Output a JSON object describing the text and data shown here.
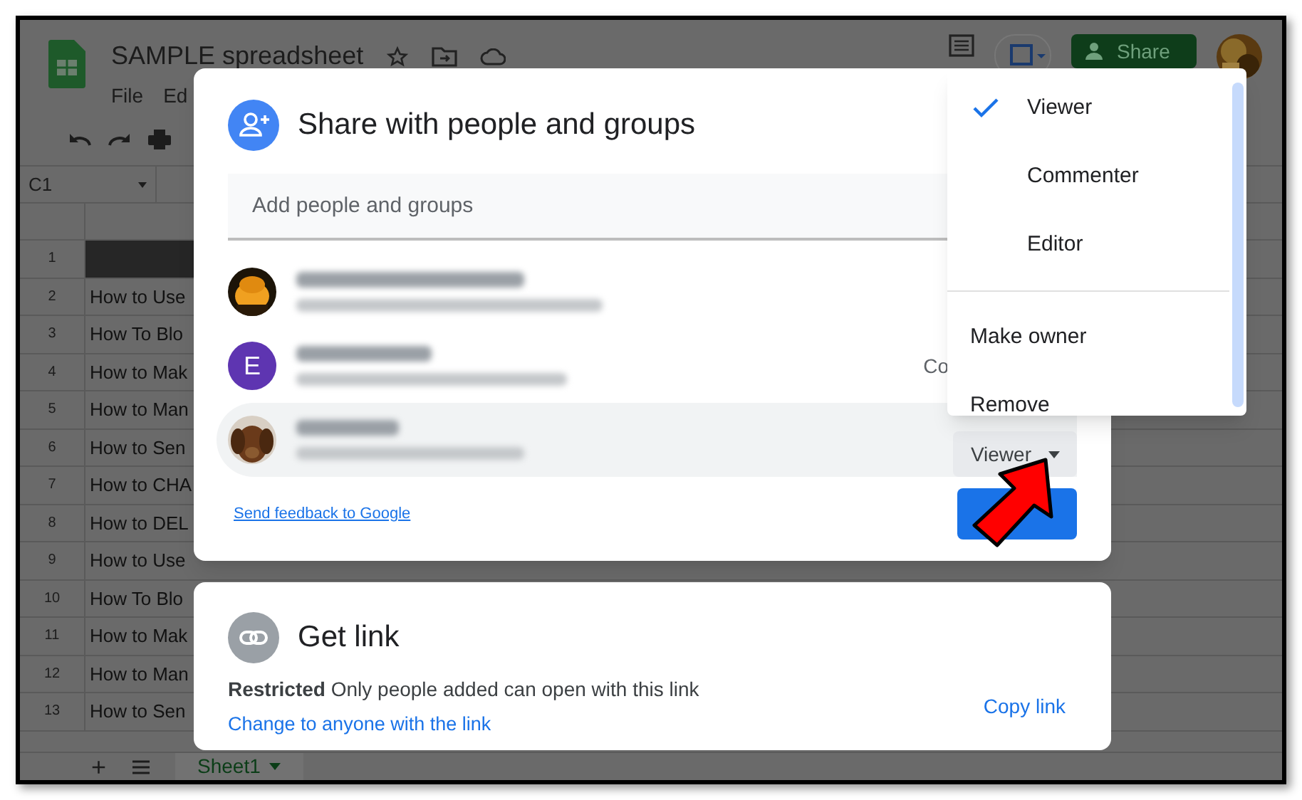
{
  "app": {
    "title": "SAMPLE spreadsheet",
    "menus": [
      "File",
      "Ed"
    ],
    "share_button": "Share",
    "name_box": "C1"
  },
  "sheet": {
    "rows": [
      {
        "number": "1"
      },
      {
        "number": "2",
        "cell": "How to Use"
      },
      {
        "number": "3",
        "cell": "How To Blo"
      },
      {
        "number": "4",
        "cell": "How to Mak"
      },
      {
        "number": "5",
        "cell": "How to Man"
      },
      {
        "number": "6",
        "cell": "How to Sen"
      },
      {
        "number": "7",
        "cell": "How to CHA"
      },
      {
        "number": "8",
        "cell": "How to DEL"
      },
      {
        "number": "9",
        "cell": "How to Use"
      },
      {
        "number": "10",
        "cell": "How To Blo"
      },
      {
        "number": "11",
        "cell": "How to Mak"
      },
      {
        "number": "12",
        "cell": "How to Man"
      },
      {
        "number": "13",
        "cell": "How to Sen"
      }
    ]
  },
  "add_sheet": "+",
  "tabs": [
    {
      "label": "Sheet1",
      "selected": true
    }
  ],
  "dialog": {
    "title": "Share with people and groups",
    "search": {
      "placeholder": "Add people and groups"
    },
    "people": [
      {
        "selected": false
      },
      {
        "avatar": {
          "kind": "letter",
          "letter": "E",
          "color": "#5e35b1"
        },
        "selected": false,
        "role": {
          "kind": "text",
          "label": "Co"
        }
      },
      {
        "selected": true,
        "role": {
          "kind": "dropdown",
          "label": "Viewer"
        }
      }
    ],
    "feedback_link": "Send feedback to Google"
  },
  "role_menu": {
    "items": [
      {
        "kind": "option",
        "label": "Viewer",
        "selected": true
      },
      {
        "kind": "option",
        "label": "Commenter",
        "selected": false
      },
      {
        "kind": "option",
        "label": "Editor",
        "selected": false
      },
      {
        "kind": "action",
        "label": "Make owner"
      },
      {
        "kind": "action",
        "label": "Remove"
      }
    ]
  },
  "link_card": {
    "title": "Get link",
    "access": "**Restricted** Only people added can open with this link",
    "change_link": "Change to anyone with the link",
    "copy_link": "Copy link"
  }
}
